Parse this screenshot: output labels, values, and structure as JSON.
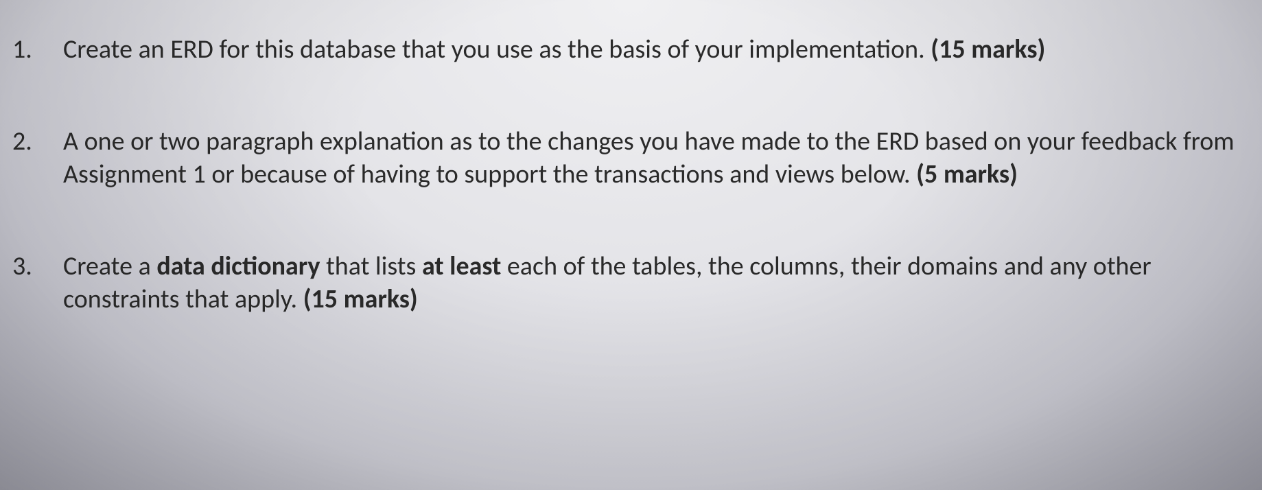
{
  "items": [
    {
      "number": "1.",
      "text_parts": [
        {
          "text": "Create an ERD for this database that you use as the basis of your implementation. ",
          "bold": false
        },
        {
          "text": "(15 marks)",
          "bold": true
        }
      ]
    },
    {
      "number": "2.",
      "text_parts": [
        {
          "text": "A one or two paragraph explanation as to the changes you have made to the ERD based on your feedback from Assignment 1 or because of having to support the transactions and views below. ",
          "bold": false
        },
        {
          "text": "(5 marks)",
          "bold": true
        }
      ]
    },
    {
      "number": "3.",
      "text_parts": [
        {
          "text": "Create a ",
          "bold": false
        },
        {
          "text": "data dictionary",
          "bold": true
        },
        {
          "text": " that lists ",
          "bold": false
        },
        {
          "text": "at least",
          "bold": true
        },
        {
          "text": " each of the tables, the columns, their domains and any other constraints that apply. ",
          "bold": false
        },
        {
          "text": "(15 marks)",
          "bold": true
        }
      ]
    }
  ]
}
